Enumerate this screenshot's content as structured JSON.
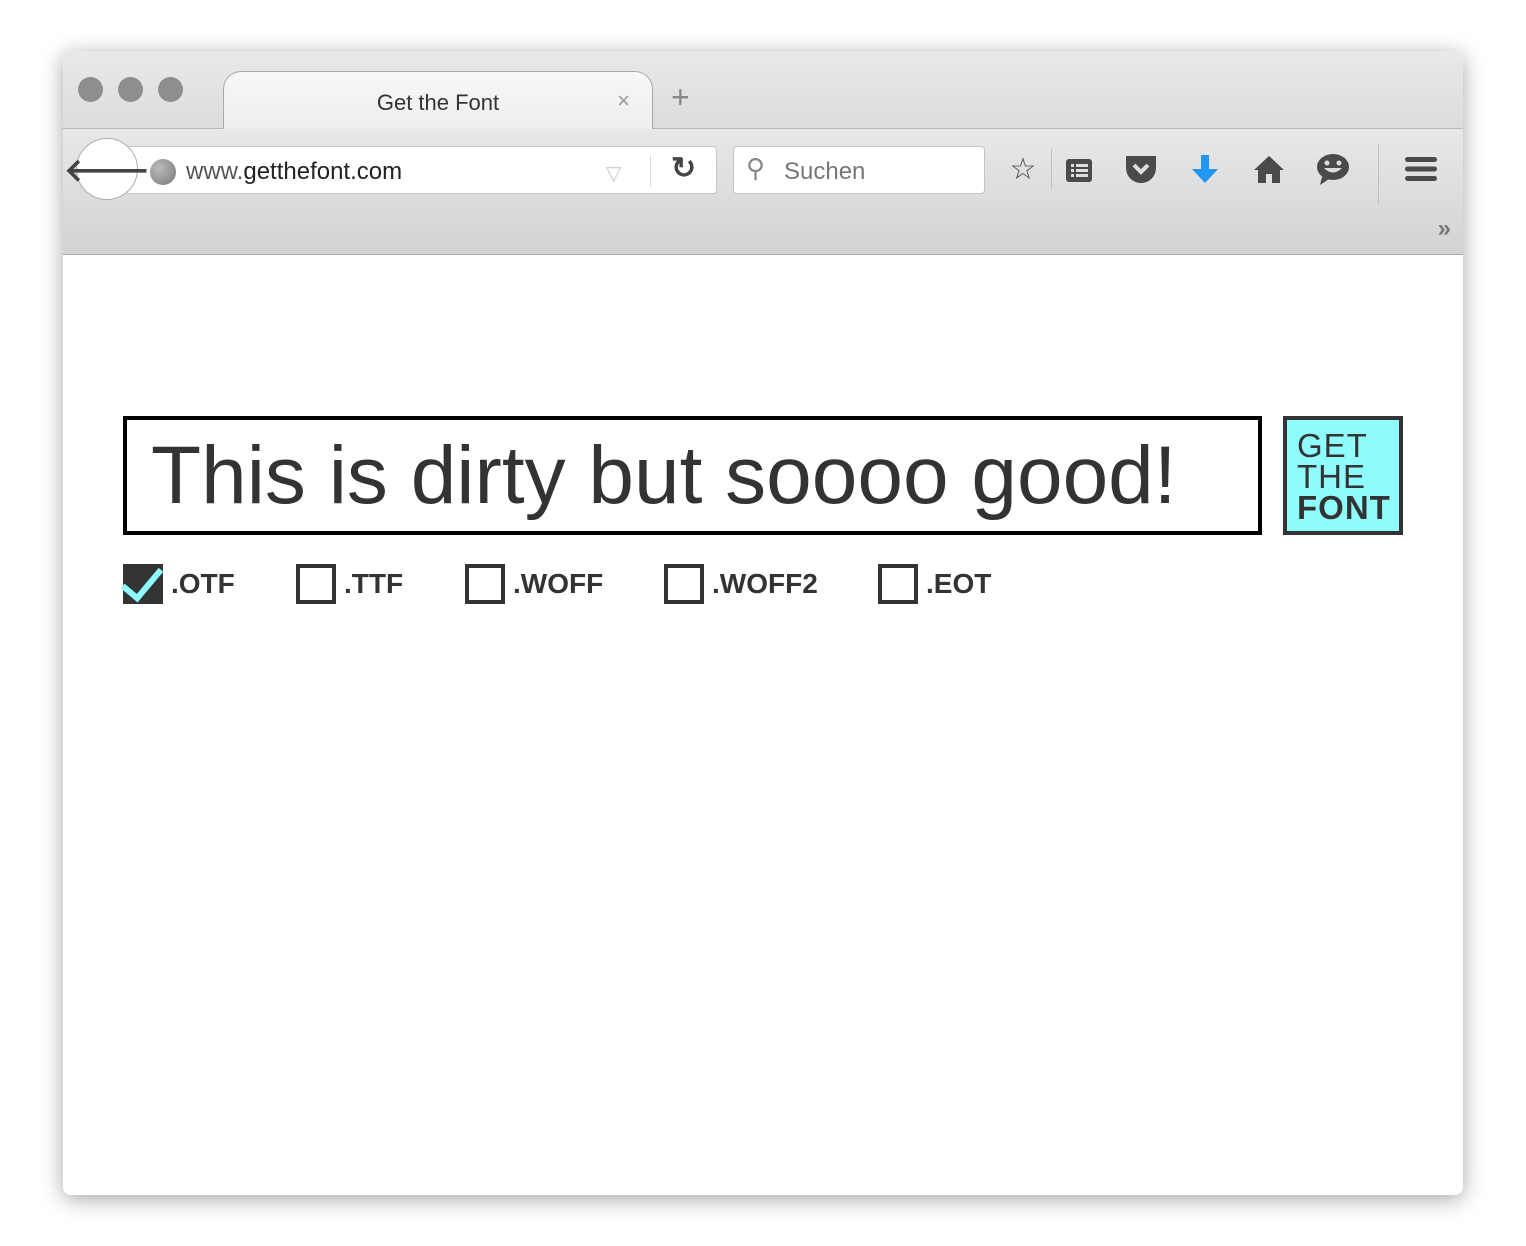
{
  "browser": {
    "tab_title": "Get the Font",
    "tab_close": "×",
    "new_tab": "+",
    "url_prefix": "www.",
    "url_domain": "getthefont.com",
    "search_placeholder": "Suchen",
    "accent_download": "#2196f3"
  },
  "page": {
    "preview_text": "This is dirty but soooo good!",
    "button": {
      "line1": "GET",
      "line2": "THE",
      "line3": "FONT",
      "bg": "#8ffdfd"
    },
    "formats": [
      {
        "label": ".OTF",
        "checked": true
      },
      {
        "label": ".TTF",
        "checked": false
      },
      {
        "label": ".WOFF",
        "checked": false
      },
      {
        "label": ".WOFF2",
        "checked": false
      },
      {
        "label": ".EOT",
        "checked": false
      }
    ]
  }
}
